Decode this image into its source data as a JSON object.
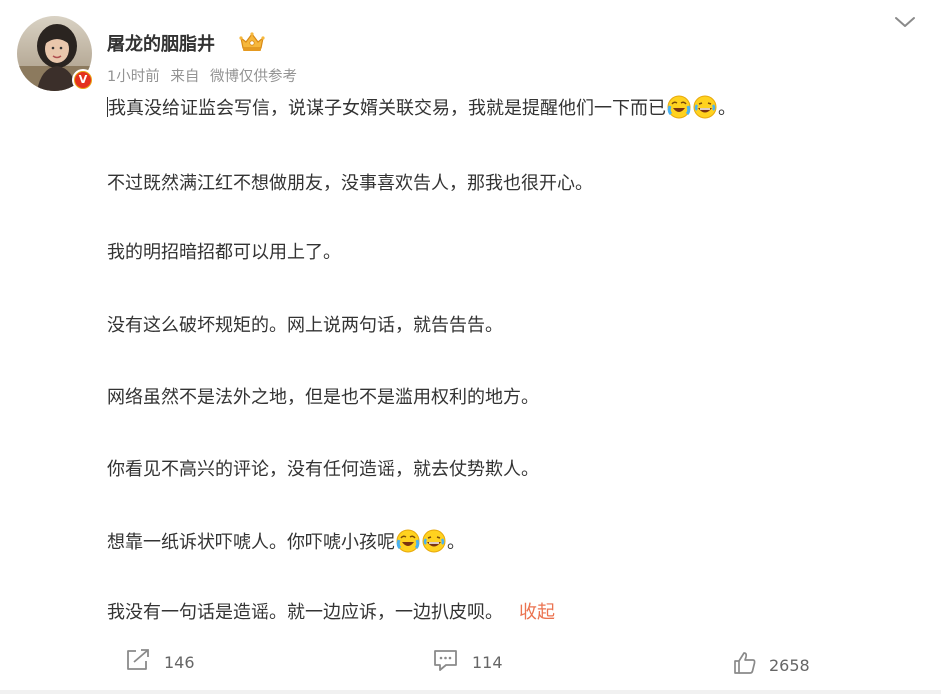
{
  "post": {
    "author": "屠龙的胭脂井",
    "time": "1小时前",
    "source_prefix": "来自",
    "source": "微博仅供参考",
    "paragraphs": [
      {
        "text": "我真没给证监会写信，说谋子女婿关联交易，我就是提醒他们一下而已",
        "suffix": "。",
        "emojis": [
          "laugh-cry",
          "grin-tears"
        ]
      },
      {
        "text": "不过既然满江红不想做朋友，没事喜欢告人，那我也很开心。",
        "suffix": "",
        "emojis": []
      },
      {
        "text": "我的明招暗招都可以用上了。",
        "suffix": "",
        "emojis": []
      },
      {
        "text": "没有这么破坏规矩的。网上说两句话，就告告告。",
        "suffix": "",
        "emojis": []
      },
      {
        "text": "网络虽然不是法外之地，但是也不是滥用权利的地方。",
        "suffix": "",
        "emojis": []
      },
      {
        "text": "你看见不高兴的评论，没有任何造谣，就去仗势欺人。",
        "suffix": "",
        "emojis": []
      },
      {
        "text": "想靠一纸诉状吓唬人。你吓唬小孩呢",
        "suffix": "。",
        "emojis": [
          "laugh-cry",
          "grin-tears"
        ]
      },
      {
        "text": "我没有一句话是造谣。就一边应诉，一边扒皮呗。",
        "suffix": "",
        "emojis": []
      }
    ],
    "collapse_label": "收起",
    "actions": {
      "repost_count": "146",
      "comment_count": "114",
      "like_count": "2658"
    }
  },
  "colors": {
    "link": "#eb7350",
    "meta": "#939393",
    "text": "#333333",
    "icon": "#8a8a8a"
  }
}
